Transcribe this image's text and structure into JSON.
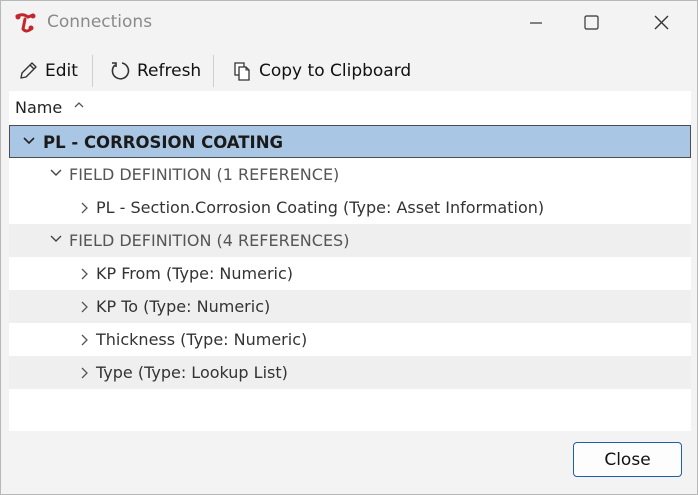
{
  "window": {
    "title": "Connections",
    "icons": {
      "app": "connections-app-icon",
      "minimize": "minimize-icon",
      "maximize": "maximize-icon",
      "close": "close-icon"
    }
  },
  "toolbar": {
    "edit_label": "Edit",
    "refresh_label": "Refresh",
    "copy_label": "Copy to Clipboard",
    "icons": {
      "edit": "pencil-icon",
      "refresh": "refresh-icon",
      "copy": "copy-icon"
    }
  },
  "tree": {
    "column_header": "Name",
    "sort": "ascending",
    "rows": [
      {
        "level": 0,
        "expanded": true,
        "selected": true,
        "label": "PL - CORROSION COATING"
      },
      {
        "level": 1,
        "expanded": true,
        "label": "FIELD DEFINITION (1 REFERENCE)"
      },
      {
        "level": 2,
        "expanded": false,
        "label": "PL - Section.Corrosion Coating (Type: Asset Information)"
      },
      {
        "level": 1,
        "expanded": true,
        "label": "FIELD DEFINITION (4 REFERENCES)"
      },
      {
        "level": 2,
        "expanded": false,
        "label": "KP From (Type: Numeric)"
      },
      {
        "level": 2,
        "expanded": false,
        "label": "KP To (Type: Numeric)"
      },
      {
        "level": 2,
        "expanded": false,
        "label": "Thickness (Type: Numeric)"
      },
      {
        "level": 2,
        "expanded": false,
        "label": "Type (Type: Lookup List)"
      }
    ]
  },
  "footer": {
    "close_label": "Close"
  },
  "colors": {
    "selection": "#a9c7e4",
    "accent_border": "#1f5fa8",
    "app_icon": "#c0282d"
  }
}
